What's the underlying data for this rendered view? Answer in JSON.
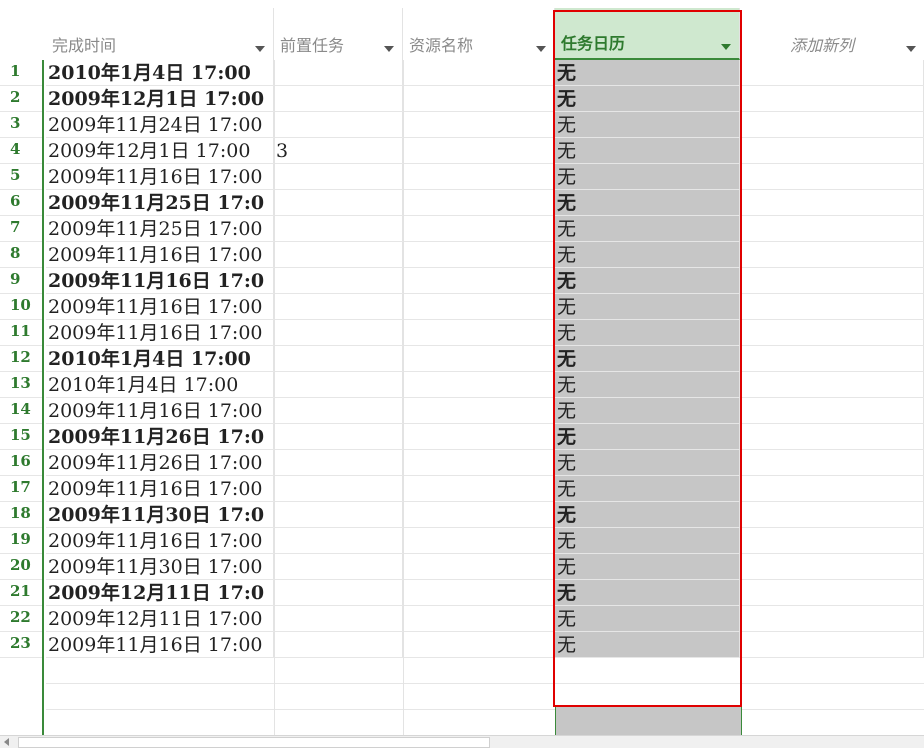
{
  "columns": {
    "finish_time": "完成时间",
    "predecessors": "前置任务",
    "resource_names": "资源名称",
    "task_calendar": "任务日历",
    "add_new_column": "添加新列"
  },
  "rows": [
    {
      "num": "1",
      "finish": "2010年1月4日 17:00",
      "pred": "",
      "cal": "无",
      "bold": true
    },
    {
      "num": "2",
      "finish": "2009年12月1日 17:00",
      "pred": "",
      "cal": "无",
      "bold": true
    },
    {
      "num": "3",
      "finish": "2009年11月24日 17:00",
      "pred": "",
      "cal": "无",
      "bold": false
    },
    {
      "num": "4",
      "finish": "2009年12月1日 17:00",
      "pred": "3",
      "cal": "无",
      "bold": false
    },
    {
      "num": "5",
      "finish": "2009年11月16日 17:00",
      "pred": "",
      "cal": "无",
      "bold": false
    },
    {
      "num": "6",
      "finish": "2009年11月25日 17:0",
      "pred": "",
      "cal": "无",
      "bold": true
    },
    {
      "num": "7",
      "finish": "2009年11月25日 17:00",
      "pred": "",
      "cal": "无",
      "bold": false
    },
    {
      "num": "8",
      "finish": "2009年11月16日 17:00",
      "pred": "",
      "cal": "无",
      "bold": false
    },
    {
      "num": "9",
      "finish": "2009年11月16日 17:0",
      "pred": "",
      "cal": "无",
      "bold": true
    },
    {
      "num": "10",
      "finish": "2009年11月16日 17:00",
      "pred": "",
      "cal": "无",
      "bold": false
    },
    {
      "num": "11",
      "finish": "2009年11月16日 17:00",
      "pred": "",
      "cal": "无",
      "bold": false
    },
    {
      "num": "12",
      "finish": "2010年1月4日 17:00",
      "pred": "",
      "cal": "无",
      "bold": true
    },
    {
      "num": "13",
      "finish": "2010年1月4日 17:00",
      "pred": "",
      "cal": "无",
      "bold": false
    },
    {
      "num": "14",
      "finish": "2009年11月16日 17:00",
      "pred": "",
      "cal": "无",
      "bold": false
    },
    {
      "num": "15",
      "finish": "2009年11月26日 17:0",
      "pred": "",
      "cal": "无",
      "bold": true
    },
    {
      "num": "16",
      "finish": "2009年11月26日 17:00",
      "pred": "",
      "cal": "无",
      "bold": false
    },
    {
      "num": "17",
      "finish": "2009年11月16日 17:00",
      "pred": "",
      "cal": "无",
      "bold": false
    },
    {
      "num": "18",
      "finish": "2009年11月30日 17:0",
      "pred": "",
      "cal": "无",
      "bold": true
    },
    {
      "num": "19",
      "finish": "2009年11月16日 17:00",
      "pred": "",
      "cal": "无",
      "bold": false
    },
    {
      "num": "20",
      "finish": "2009年11月30日 17:00",
      "pred": "",
      "cal": "无",
      "bold": false
    },
    {
      "num": "21",
      "finish": "2009年12月11日 17:0",
      "pred": "",
      "cal": "无",
      "bold": true
    },
    {
      "num": "22",
      "finish": "2009年12月11日 17:00",
      "pred": "",
      "cal": "无",
      "bold": false
    },
    {
      "num": "23",
      "finish": "2009年11月16日 17:00",
      "pred": "",
      "cal": "无",
      "bold": false
    }
  ],
  "colors": {
    "selected_header_bg": "#cfe8cf",
    "selected_column_bg": "#c6c6c6",
    "highlight_border": "#e00000",
    "row_number_color": "#2e7a2e"
  }
}
